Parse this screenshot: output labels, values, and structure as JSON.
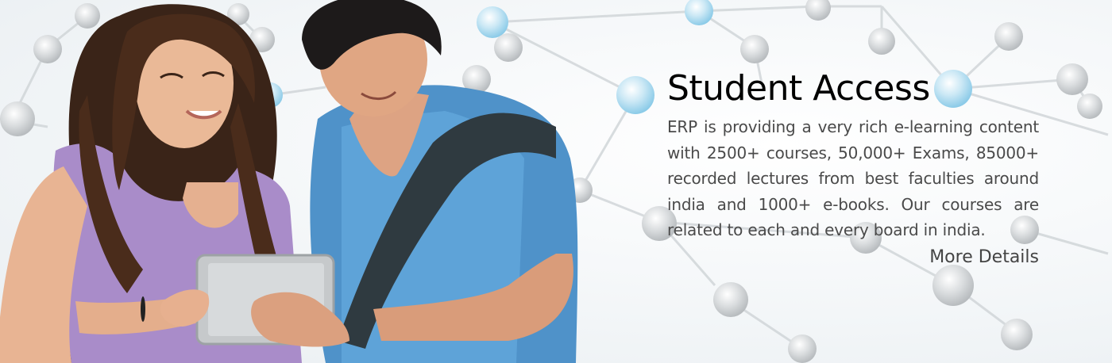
{
  "banner": {
    "title": "Student Access",
    "description": "ERP is providing a very rich e-learning content with 2500+ courses, 50,000+ Exams, 85000+ recorded lectures from best faculties around india and 1000+ e-books. Our courses are related to each and every board in india.",
    "more_link": "More Details"
  },
  "colors": {
    "title": "#000000",
    "text": "#4a4a4a",
    "node_grey": "#c9cdd0",
    "node_blue": "#a9d8ef"
  },
  "images": {
    "students": "two-students-with-tablet-photo",
    "background": "molecular-network-background"
  }
}
